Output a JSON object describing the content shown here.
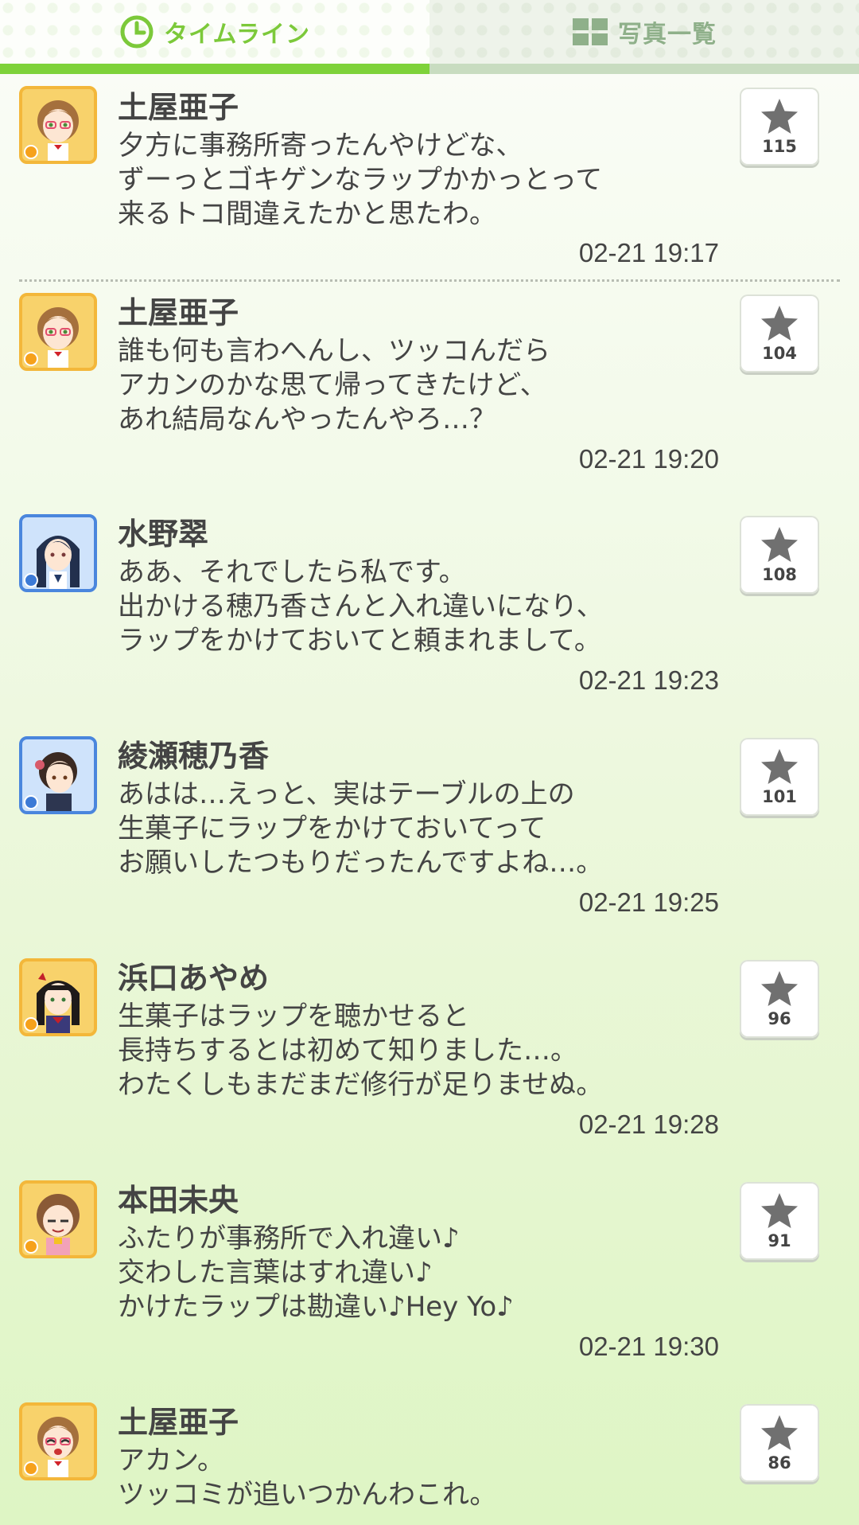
{
  "tabs": {
    "timeline_label": "タイムライン",
    "photos_label": "写真一覧",
    "active": "timeline"
  },
  "colors": {
    "accent": "#7ed23a",
    "inactive_tab": "#8fb08a"
  },
  "posts": [
    {
      "name": "土屋亜子",
      "lines": [
        "夕方に事務所寄ったんやけどな、",
        "ずーっとゴキゲンなラップかかっとって",
        "来るトコ間違えたかと思たわ。"
      ],
      "time": "02-21 19:17",
      "likes": "115",
      "avatar_type": "cute"
    },
    {
      "name": "土屋亜子",
      "lines": [
        "誰も何も言わへんし、ツッコんだら",
        "アカンのかな思て帰ってきたけど、",
        "あれ結局なんやったんやろ…？"
      ],
      "time": "02-21 19:20",
      "likes": "104",
      "avatar_type": "cute"
    },
    {
      "name": "水野翠",
      "lines": [
        "ああ、それでしたら私です。",
        "出かける穂乃香さんと入れ違いになり、",
        "ラップをかけておいてと頼まれまして。"
      ],
      "time": "02-21 19:23",
      "likes": "108",
      "avatar_type": "cool"
    },
    {
      "name": "綾瀬穂乃香",
      "lines": [
        "あはは…えっと、実はテーブルの上の",
        "生菓子にラップをかけておいてって",
        "お願いしたつもりだったんですよね…。"
      ],
      "time": "02-21 19:25",
      "likes": "101",
      "avatar_type": "cool"
    },
    {
      "name": "浜口あやめ",
      "lines": [
        "生菓子はラップを聴かせると",
        "長持ちするとは初めて知りました…。",
        "わたくしもまだまだ修行が足りませぬ。"
      ],
      "time": "02-21 19:28",
      "likes": "96",
      "avatar_type": "cute"
    },
    {
      "name": "本田未央",
      "lines": [
        "ふたりが事務所で入れ違い♪",
        "交わした言葉はすれ違い♪",
        "かけたラップは勘違い♪Hey Yo♪"
      ],
      "time": "02-21 19:30",
      "likes": "91",
      "avatar_type": "cute"
    },
    {
      "name": "土屋亜子",
      "lines": [
        "アカン。",
        "ツッコミが追いつかんわこれ。"
      ],
      "time": "",
      "likes": "86",
      "avatar_type": "cute"
    }
  ]
}
